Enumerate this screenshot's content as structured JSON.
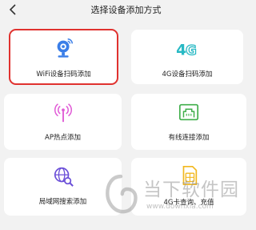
{
  "header": {
    "title": "选择设备添加方式"
  },
  "options": [
    {
      "label": "WiFi设备扫码添加",
      "icon": "wifi-camera-icon",
      "selected": true
    },
    {
      "label": "4G设备扫码添加",
      "icon": "4g-icon",
      "selected": false
    },
    {
      "label": "AP热点添加",
      "icon": "antenna-icon",
      "selected": false
    },
    {
      "label": "有线连接添加",
      "icon": "ethernet-port-icon",
      "selected": false
    },
    {
      "label": "局域网搜索添加",
      "icon": "network-search-icon",
      "selected": false
    },
    {
      "label": "4G卡查询、充值",
      "icon": "sim-card-icon",
      "selected": false
    }
  ],
  "watermark": {
    "text": "当下软件园",
    "url": "www.downxia.com"
  },
  "colors": {
    "background": "#f2f2f2",
    "card": "#ffffff",
    "selected_outline": "#e0322f",
    "blue_icon": "#3a7ee8",
    "teal_icon": "#27b9c4",
    "pink_icon": "#e05ad6",
    "green_icon": "#3fae4a",
    "purple_icon": "#6b4fd8",
    "yellow_icon": "#f2b81f"
  }
}
